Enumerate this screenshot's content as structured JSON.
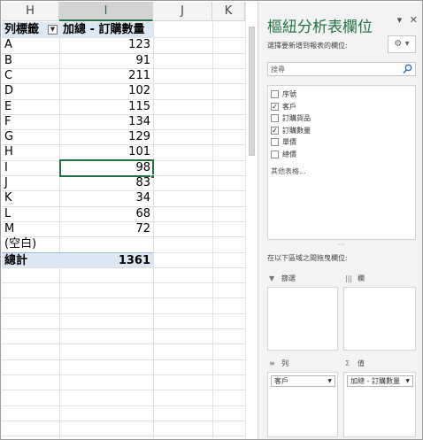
{
  "sheet": {
    "columns": [
      "H",
      "I",
      "J",
      "K"
    ],
    "header": {
      "row_label": "列標籤",
      "value_label": "加總 - 訂購數量"
    },
    "rows": [
      {
        "label": "A",
        "value": "123"
      },
      {
        "label": "B",
        "value": "91"
      },
      {
        "label": "C",
        "value": "211"
      },
      {
        "label": "D",
        "value": "102"
      },
      {
        "label": "E",
        "value": "115"
      },
      {
        "label": "F",
        "value": "134"
      },
      {
        "label": "G",
        "value": "129"
      },
      {
        "label": "H",
        "value": "101"
      },
      {
        "label": "I",
        "value": "98"
      },
      {
        "label": "J",
        "value": "83"
      },
      {
        "label": "K",
        "value": "34"
      },
      {
        "label": "L",
        "value": "68"
      },
      {
        "label": "M",
        "value": "72"
      },
      {
        "label": "(空白)",
        "value": ""
      }
    ],
    "total": {
      "label": "總計",
      "value": "1361"
    },
    "active_cell_row": 9
  },
  "pane": {
    "title": "樞紐分析表欄位",
    "choose_label": "選擇要新增到報表的欄位:",
    "search_placeholder": "搜尋",
    "fields": [
      {
        "label": "序號",
        "checked": false
      },
      {
        "label": "客戶",
        "checked": true
      },
      {
        "label": "訂購貨品",
        "checked": false
      },
      {
        "label": "訂購數量",
        "checked": true
      },
      {
        "label": "單價",
        "checked": false
      },
      {
        "label": "總價",
        "checked": false
      }
    ],
    "more_tables": "其他表格...",
    "drag_label": "在以下區域之間拖曳欄位:",
    "areas": {
      "filters": "篩選",
      "columns": "欄",
      "rows": "列",
      "values": "值"
    },
    "row_chip": "客戶",
    "value_chip": "加總 - 訂購數量"
  },
  "colors": {
    "accent": "#217346",
    "pivot_header": "#dde8f5"
  }
}
